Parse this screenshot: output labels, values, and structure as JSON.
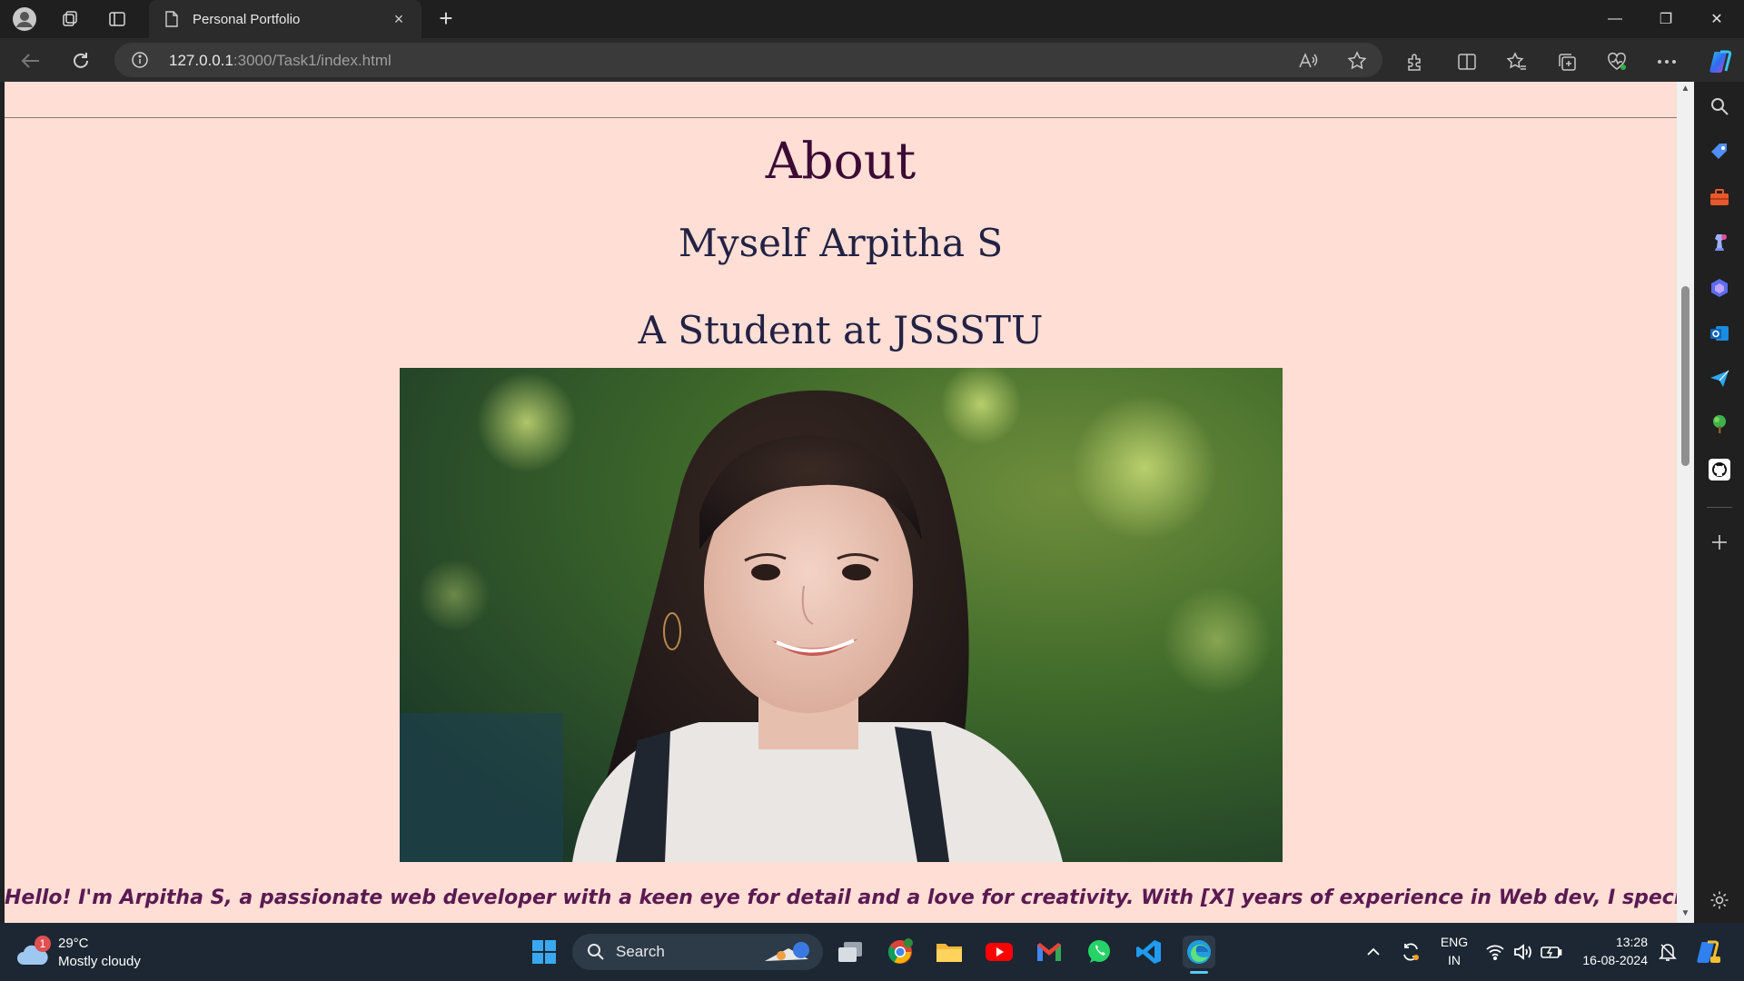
{
  "browser": {
    "tab_title": "Personal Portfolio",
    "tab_close": "×",
    "new_tab": "+",
    "url_host": "127.0.0.1",
    "url_path": ":3000/Task1/index.html",
    "window_controls": {
      "minimize": "—",
      "restore": "❐",
      "close": "✕"
    }
  },
  "page": {
    "heading": "About",
    "name_line": "Myself Arpitha S",
    "student_line": "A Student at JSSSTU",
    "bio": "Hello! I'm Arpitha S, a passionate web developer with a keen eye for detail and a love for creativity. With [X] years of experience in Web dev, I specialize in Full",
    "background_color": "#ffded5"
  },
  "sidebar_icons": [
    "search-icon",
    "tag-icon",
    "toolbox-icon",
    "chess-icon",
    "copilot-icon",
    "outlook-icon",
    "send-icon",
    "tree-icon",
    "github-icon",
    "add-icon",
    "settings-icon"
  ],
  "taskbar": {
    "weather_badge": "1",
    "temperature": "29°C",
    "condition": "Mostly cloudy",
    "search_label": "Search",
    "lang_line1": "ENG",
    "lang_line2": "IN",
    "time": "13:28",
    "date": "16-08-2024"
  }
}
